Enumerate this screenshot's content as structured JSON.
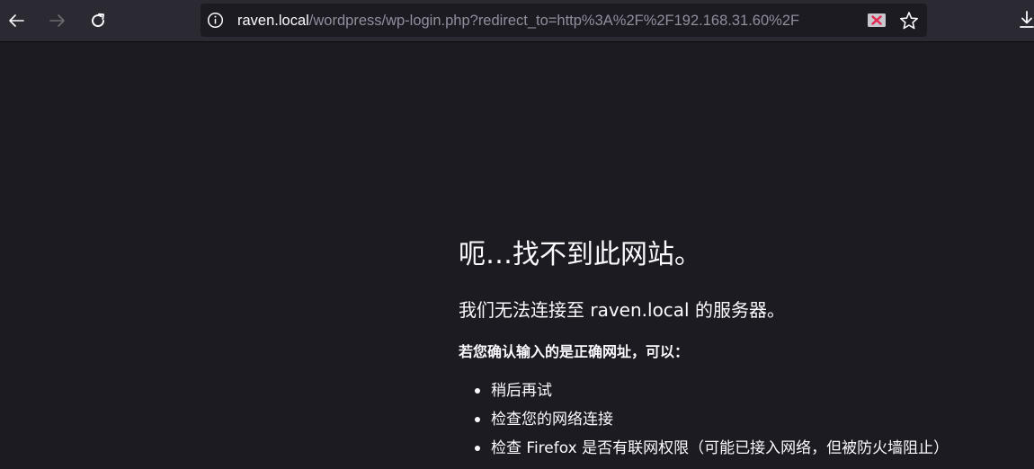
{
  "toolbar": {
    "back_icon": "arrow-left-icon",
    "forward_icon": "arrow-right-icon",
    "reload_icon": "reload-icon",
    "download_icon": "download-icon"
  },
  "urlbar": {
    "info_icon": "info-icon",
    "url_host": "raven.local",
    "url_rest": "/wordpress/wp-login.php?redirect_to=http%3A%2F%2F192.168.31.60%2F",
    "tracking_icon": "tracking-protection-icon",
    "bookmark_icon": "star-icon"
  },
  "error": {
    "title": "呃…找不到此网站。",
    "description": "我们无法连接至 raven.local 的服务器。",
    "hint": "若您确认输入的是正确网址，可以：",
    "suggestions": [
      "稍后再试",
      "检查您的网络连接",
      "检查 Firefox 是否有联网权限（可能已接入网络，但被防火墙阻止）"
    ]
  },
  "colors": {
    "toolbar_bg": "#2b2a33",
    "page_bg": "#1c1b22",
    "text": "#fbfbfe",
    "url_dim": "#8f8f9d"
  }
}
